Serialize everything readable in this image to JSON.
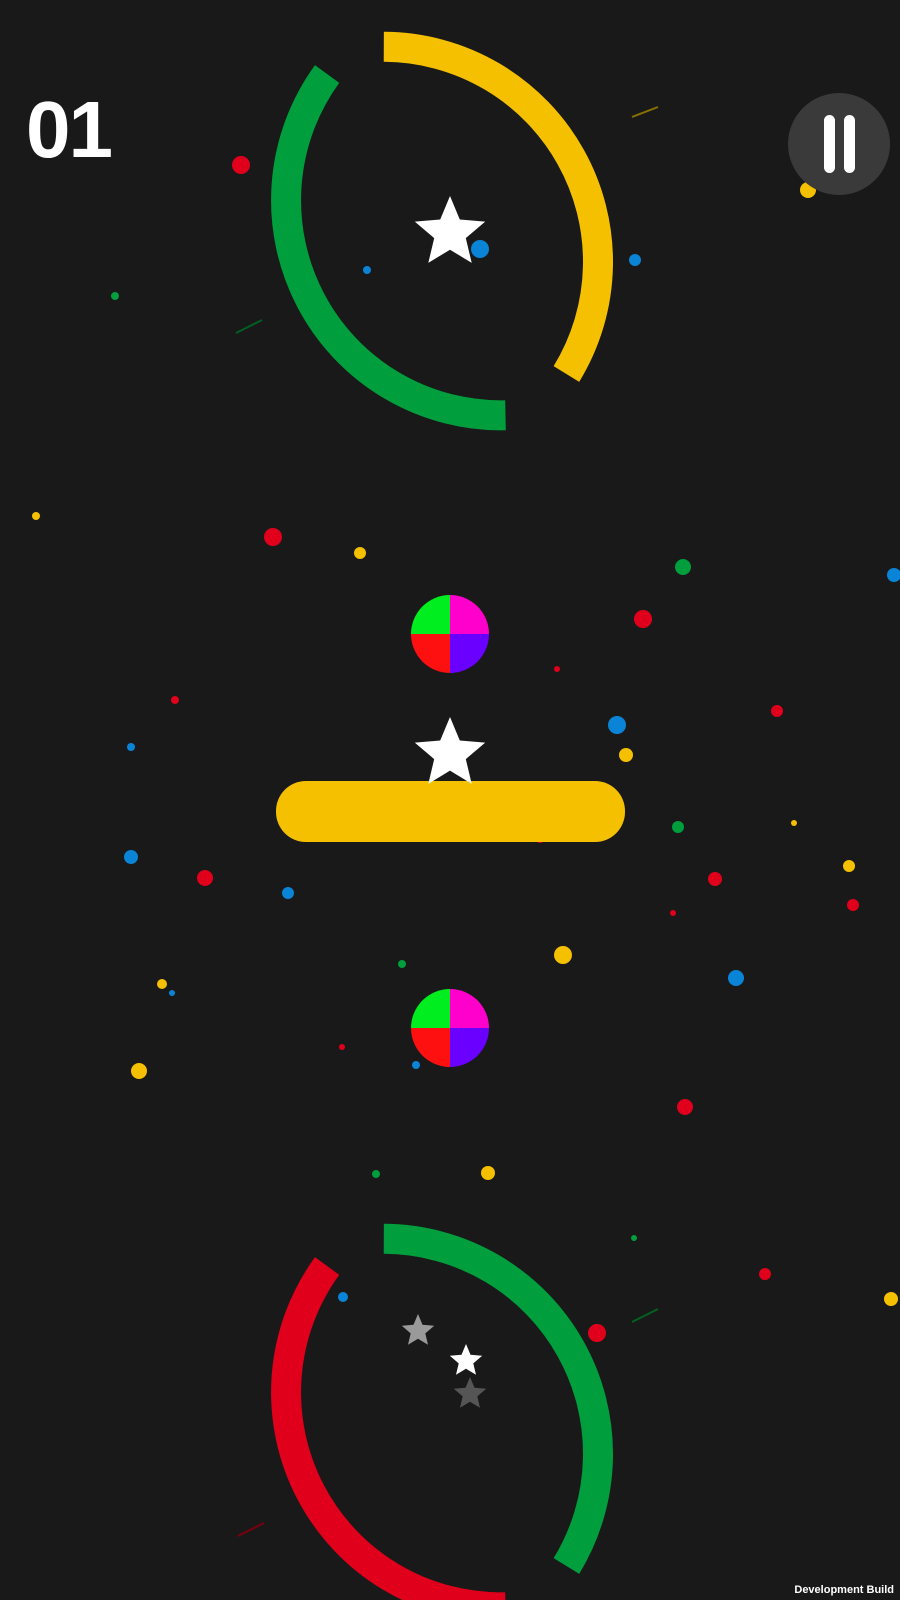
{
  "hud": {
    "score": "01",
    "footer": "Development Build"
  },
  "palette": {
    "background": "#191919",
    "yellow": "#F5C000",
    "green": "#009E3C",
    "red": "#E0001B",
    "blue": "#0A84D6",
    "switcher": [
      "#00EE1F",
      "#FF00CC",
      "#FF1010",
      "#6A00FF"
    ],
    "star": "#FFFFFF",
    "pause_bg": "#3A3A3A"
  },
  "icons": {
    "pause": "pause-icon",
    "star": "star-icon",
    "color_switcher": "color-switcher-icon"
  },
  "obstacles": {
    "top_ring": [
      "green",
      "yellow"
    ],
    "bar": "yellow",
    "bottom_ring": [
      "green",
      "red"
    ]
  }
}
